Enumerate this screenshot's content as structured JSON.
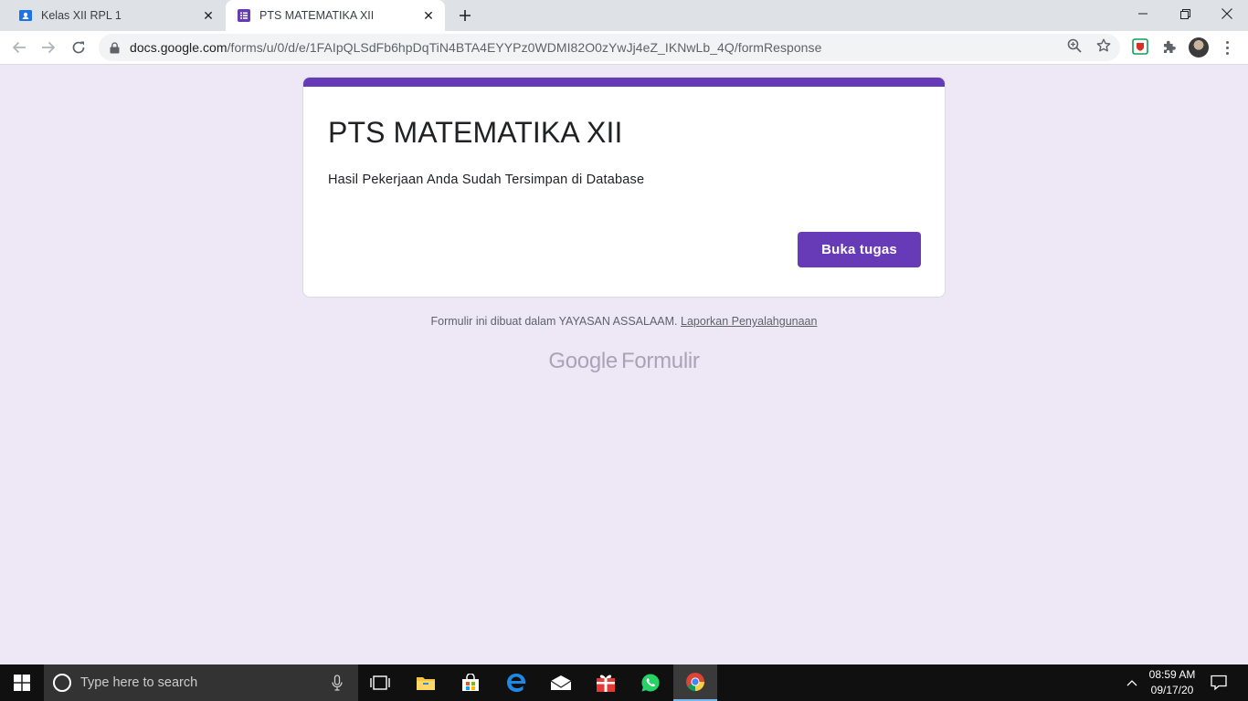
{
  "browser": {
    "tabs": [
      {
        "title": "Kelas XII RPL 1",
        "favicon": "classroom-icon",
        "active": false
      },
      {
        "title": "PTS MATEMATIKA XII",
        "favicon": "google-forms-icon",
        "active": true
      }
    ],
    "url_host": "docs.google.com",
    "url_path": "/forms/u/0/d/e/1FAIpQLSdFb6hpDqTiN4BTA4EYYPz0WDMI82O0zYwJj4eZ_IKNwLb_4Q/formResponse"
  },
  "form": {
    "accent": "#673ab7",
    "background": "#ede7f6",
    "title": "PTS MATEMATIKA XII",
    "message": "Hasil Pekerjaan Anda Sudah Tersimpan di Database",
    "button_label": "Buka tugas"
  },
  "footer": {
    "text": "Formulir ini dibuat dalam YAYASAN ASSALAAM.",
    "report_link": "Laporkan Penyalahgunaan",
    "brand_google": "Google",
    "brand_product": "Formulir"
  },
  "taskbar": {
    "search_placeholder": "Type here to search",
    "time": "08:59 AM",
    "date": "09/17/20"
  }
}
